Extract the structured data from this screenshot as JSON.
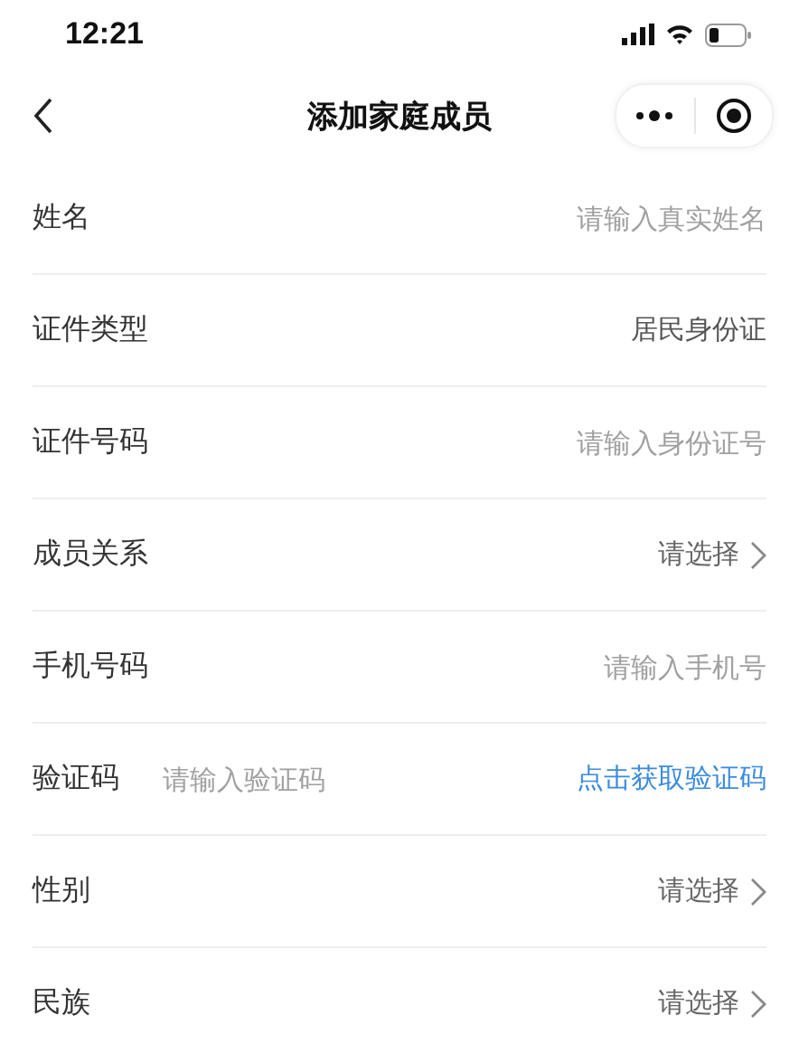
{
  "status_bar": {
    "time": "12:21"
  },
  "nav": {
    "title": "添加家庭成员"
  },
  "fields": [
    {
      "kind": "input",
      "label": "姓名",
      "placeholder": "请输入真实姓名"
    },
    {
      "kind": "value",
      "label": "证件类型",
      "value": "居民身份证"
    },
    {
      "kind": "input",
      "label": "证件号码",
      "placeholder": "请输入身份证号"
    },
    {
      "kind": "select",
      "label": "成员关系",
      "placeholder": "请选择"
    },
    {
      "kind": "input",
      "label": "手机号码",
      "placeholder": "请输入手机号"
    },
    {
      "kind": "code",
      "label": "验证码",
      "placeholder": "请输入验证码",
      "action": "点击获取验证码"
    },
    {
      "kind": "select",
      "label": "性别",
      "placeholder": "请选择"
    },
    {
      "kind": "select",
      "label": "民族",
      "placeholder": "请选择"
    }
  ]
}
